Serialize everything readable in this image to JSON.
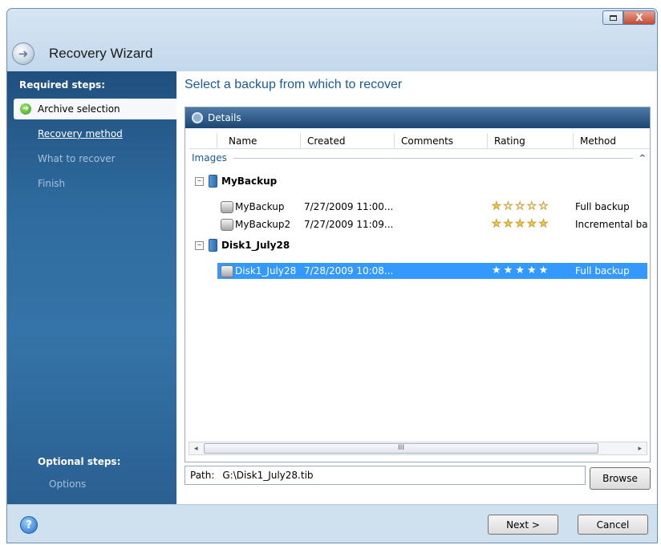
{
  "window": {
    "title": "Recovery Wizard",
    "controls": {
      "maximize": "□",
      "close": "X"
    }
  },
  "sidebar": {
    "required_heading": "Required steps:",
    "steps": [
      {
        "label": "Archive selection",
        "state": "active"
      },
      {
        "label": "Recovery method",
        "state": "link"
      },
      {
        "label": "What to recover",
        "state": "disabled"
      },
      {
        "label": "Finish",
        "state": "disabled"
      }
    ],
    "optional_heading": "Optional steps:",
    "optional_items": [
      {
        "label": "Options"
      }
    ]
  },
  "main": {
    "title": "Select a backup from which to recover",
    "panel_title": "Details",
    "columns": [
      "Name",
      "Created",
      "Comments",
      "Rating",
      "Method"
    ],
    "group_label": "Images",
    "archives": [
      {
        "name": "MyBackup",
        "backups": [
          {
            "name": "MyBackup",
            "created": "7/27/2009 11:00...",
            "comments": "",
            "rating": 1,
            "method": "Full backup",
            "selected": false
          },
          {
            "name": "MyBackup2",
            "created": "7/27/2009 11:09...",
            "comments": "",
            "rating": 5,
            "method": "Incremental bac",
            "selected": false
          }
        ]
      },
      {
        "name": "Disk1_July28",
        "backups": [
          {
            "name": "Disk1_July28",
            "created": "7/28/2009 10:08...",
            "comments": "",
            "rating": 5,
            "method": "Full backup",
            "selected": true
          }
        ]
      }
    ],
    "scrollbar": {
      "left_arrow": "◂",
      "grip": "III",
      "right_arrow": "▸"
    },
    "path_label": "Path:",
    "path_value": "G:\\Disk1_July28.tib",
    "browse_label": "Browse"
  },
  "footer": {
    "help_label": "?",
    "next_label": "Next >",
    "cancel_label": "Cancel"
  },
  "colors": {
    "sidebar": "#2e6a9d",
    "accent_title": "#1a5a95",
    "selection": "#3399ff",
    "star": "#f6cb3d"
  },
  "icons": [
    "back-arrow-icon",
    "step-arrow-icon",
    "magnifier-icon",
    "archive-icon",
    "disk-icon",
    "star-icon",
    "help-icon",
    "maximize-icon",
    "close-icon"
  ]
}
